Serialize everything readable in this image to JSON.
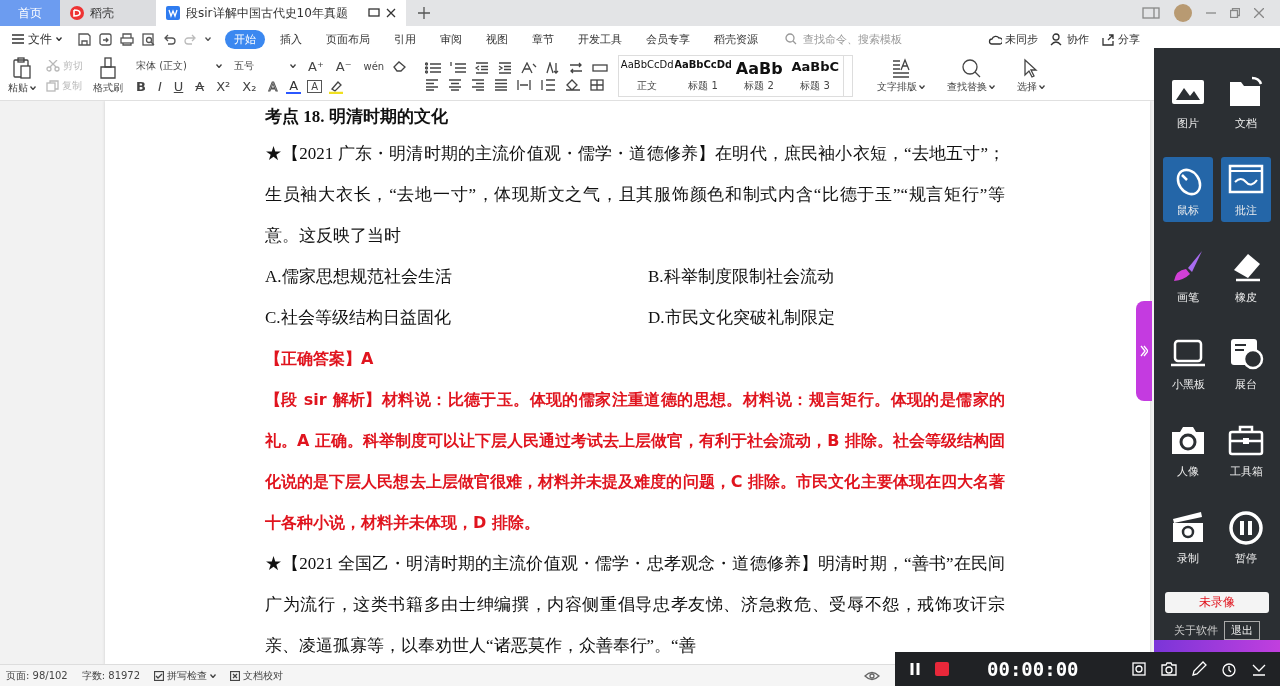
{
  "tabs": [
    {
      "label": "首页",
      "selected": false,
      "kind": "home"
    },
    {
      "label": "稻壳",
      "selected": false,
      "kind": "docer"
    },
    {
      "label": "段sir详解中国古代史10年真题",
      "selected": true,
      "kind": "doc"
    }
  ],
  "menu": {
    "file": "文件",
    "ribbon_tabs": [
      {
        "label": "开始",
        "selected": true
      },
      {
        "label": "插入",
        "selected": false
      },
      {
        "label": "页面布局",
        "selected": false
      },
      {
        "label": "引用",
        "selected": false
      },
      {
        "label": "审阅",
        "selected": false
      },
      {
        "label": "视图",
        "selected": false
      },
      {
        "label": "章节",
        "selected": false
      },
      {
        "label": "开发工具",
        "selected": false
      },
      {
        "label": "会员专享",
        "selected": false
      },
      {
        "label": "稻壳资源",
        "selected": false
      }
    ],
    "search": {
      "placeholder": "查找命令、搜索模板"
    },
    "actions": [
      {
        "label": "未同步",
        "kind": "cloud"
      },
      {
        "label": "协作",
        "kind": "collab"
      },
      {
        "label": "分享",
        "kind": "share"
      }
    ]
  },
  "toolbar": {
    "paste": "粘贴",
    "cut": {
      "label": "剪切",
      "disabled": true
    },
    "copy": {
      "label": "复制",
      "disabled": true
    },
    "format_painter": "格式刷",
    "font": "宋体 (正文)",
    "size": "五号",
    "glyphs": [
      {
        "glyph": "B",
        "kind": "bold"
      },
      {
        "glyph": "I",
        "kind": "italic"
      },
      {
        "glyph": "U",
        "kind": "underline"
      },
      {
        "glyph": "A",
        "kind": "strike"
      },
      {
        "glyph": "X²",
        "kind": "plain"
      },
      {
        "glyph": "X₂",
        "kind": "plain"
      },
      {
        "glyph": "A",
        "kind": "outline"
      },
      {
        "glyph": "A",
        "kind": "color"
      },
      {
        "glyph": "A",
        "kind": "border"
      }
    ],
    "size_glyphs": [
      {
        "glyph": "A⁺",
        "kind": "plain"
      },
      {
        "glyph": "A⁻",
        "kind": "plain"
      },
      {
        "glyph": "wén",
        "kind": "pinyin"
      }
    ],
    "styles": [
      {
        "preview": "AaBbCcDd",
        "label": "正文",
        "kind": "normal"
      },
      {
        "preview": "AaBbCcDd",
        "label": "标题 1",
        "kind": "h1"
      },
      {
        "preview": "AaBb",
        "label": "标题 2",
        "kind": "h2"
      },
      {
        "preview": "AaBbC",
        "label": "标题 3",
        "kind": "h3"
      }
    ],
    "tools": [
      {
        "label": "文字排版",
        "kind": "layout"
      },
      {
        "label": "查找替换",
        "kind": "find"
      },
      {
        "label": "选择",
        "kind": "select"
      }
    ]
  },
  "document": {
    "heading": "考点 18. 明清时期的文化",
    "blocks": [
      {
        "kind": "question",
        "text": "★【2021 广东・明清时期的主流价值观・儒学・道德修养】在明代，庶民袖小衣短，“去地五寸”；生员袖大衣长，“去地一寸”，体现斯文之气，且其服饰颜色和制式内含“比德于玉”“规言矩行”等意。这反映了当时"
      },
      {
        "kind": "options",
        "options": [
          "A.儒家思想规范社会生活",
          "B.科举制度限制社会流动",
          "C.社会等级结构日益固化",
          "D.市民文化突破礼制限定"
        ]
      },
      {
        "kind": "answer",
        "text": "【正确答案】A"
      },
      {
        "kind": "analysis",
        "text": "【段 sir 解析】材料说：比德于玉。体现的儒家注重道德的思想。材料说：规言矩行。体现的是儒家的礼。A 正确。科举制度可以让下层人民通过考试去上层做官，有利于社会流动，B 排除。社会等级结构固化说的是下层人民想去上层做官很难，材料并未提及难度的问题，C 排除。市民文化主要体现在四大名著十各种小说，材料并未体现，D 排除。"
      },
      {
        "kind": "question",
        "text": "★【2021 全国乙・明清时期的主流价值观・儒学・忠孝观念・道德修养】明清时期，“善书”在民间广为流行，这类书籍多由士绅编撰，内容侧重倡导忠孝友悌、济急救危、受辱不怨，戒饰攻讦宗亲、凌逼孤寡等，以奉劝世人“诸恶莫作，众善奉行”。“善"
      }
    ]
  },
  "side_panel": {
    "tools": [
      {
        "label": "图片",
        "kind": "picture",
        "selected": false
      },
      {
        "label": "文档",
        "kind": "folder",
        "selected": false
      },
      {
        "label": "鼠标",
        "kind": "mouse",
        "selected": true
      },
      {
        "label": "批注",
        "kind": "annotate",
        "selected": true
      },
      {
        "label": "画笔",
        "kind": "brush",
        "selected": false
      },
      {
        "label": "橡皮",
        "kind": "eraser",
        "selected": false
      },
      {
        "label": "小黑板",
        "kind": "board",
        "selected": false
      },
      {
        "label": "展台",
        "kind": "stage",
        "selected": false
      },
      {
        "label": "人像",
        "kind": "camera",
        "selected": false
      },
      {
        "label": "工具箱",
        "kind": "toolbox",
        "selected": false
      },
      {
        "label": "录制",
        "kind": "record",
        "selected": false
      },
      {
        "label": "暂停",
        "kind": "pause",
        "selected": false
      }
    ],
    "record_status": "未录像",
    "about": "关于软件",
    "exit": "退出"
  },
  "status_bar": {
    "page": "页面: 98/102",
    "words": "字数: 81972",
    "spell_check": "拼写检查",
    "proofread": "文档校对"
  },
  "recorder": {
    "time": "00:00:00"
  }
}
